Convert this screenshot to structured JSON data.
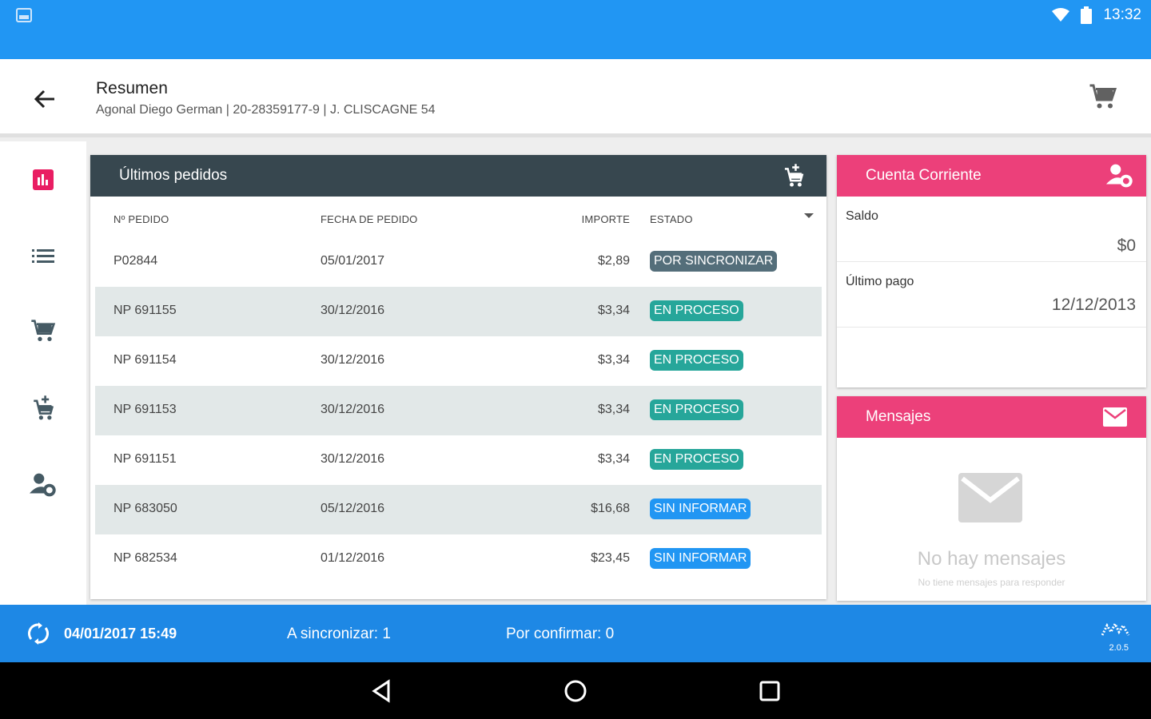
{
  "status_bar": {
    "time": "13:32",
    "left_icon": "image-icon",
    "icons": [
      "wifi-icon",
      "battery-icon"
    ]
  },
  "header": {
    "title": "Resumen",
    "subtitle": "Agonal Diego German  | 20-28359177-9 | J. CLISCAGNE 54"
  },
  "sidebar": {
    "items": [
      {
        "name": "stats",
        "icon": "bar-chart-icon",
        "active": true
      },
      {
        "name": "list",
        "icon": "list-icon",
        "active": false
      },
      {
        "name": "cart",
        "icon": "cart-icon",
        "active": false
      },
      {
        "name": "cart-add",
        "icon": "cart-plus-icon",
        "active": false
      },
      {
        "name": "customer",
        "icon": "person-money-icon",
        "active": false
      }
    ]
  },
  "orders": {
    "title": "Últimos pedidos",
    "columns": {
      "number": "Nº PEDIDO",
      "date": "FECHA DE PEDIDO",
      "amount": "IMPORTE",
      "state": "ESTADO"
    },
    "rows": [
      {
        "number": "P02844",
        "date": "05/01/2017",
        "amount": "$2,89",
        "state": "POR SINCRONIZAR",
        "color": "#546e7a"
      },
      {
        "number": "NP 691155",
        "date": "30/12/2016",
        "amount": "$3,34",
        "state": "EN PROCESO",
        "color": "#26a69a"
      },
      {
        "number": "NP 691154",
        "date": "30/12/2016",
        "amount": "$3,34",
        "state": "EN PROCESO",
        "color": "#26a69a"
      },
      {
        "number": "NP 691153",
        "date": "30/12/2016",
        "amount": "$3,34",
        "state": "EN PROCESO",
        "color": "#26a69a"
      },
      {
        "number": "NP 691151",
        "date": "30/12/2016",
        "amount": "$3,34",
        "state": "EN PROCESO",
        "color": "#26a69a"
      },
      {
        "number": "NP 683050",
        "date": "05/12/2016",
        "amount": "$16,68",
        "state": "SIN INFORMAR",
        "color": "#2196f3"
      },
      {
        "number": "NP 682534",
        "date": "01/12/2016",
        "amount": "$23,45",
        "state": "SIN INFORMAR",
        "color": "#2196f3"
      }
    ]
  },
  "account": {
    "title": "Cuenta Corriente",
    "balance_label": "Saldo",
    "balance_value": "$0",
    "last_payment_label": "Último pago",
    "last_payment_value": "12/12/2013"
  },
  "messages": {
    "title": "Mensajes",
    "empty_title": "No hay mensajes",
    "empty_subtitle": "No tiene mensajes para responder"
  },
  "sync_bar": {
    "last_sync": "04/01/2017 15:49",
    "to_sync": "A sincronizar: 1",
    "to_confirm": "Por confirmar: 0",
    "version": "2.0.5"
  },
  "colors": {
    "primary": "#2196f3",
    "header_dark": "#37474f",
    "accent_pink": "#ec407a",
    "sync_bar": "#1e88e5"
  }
}
